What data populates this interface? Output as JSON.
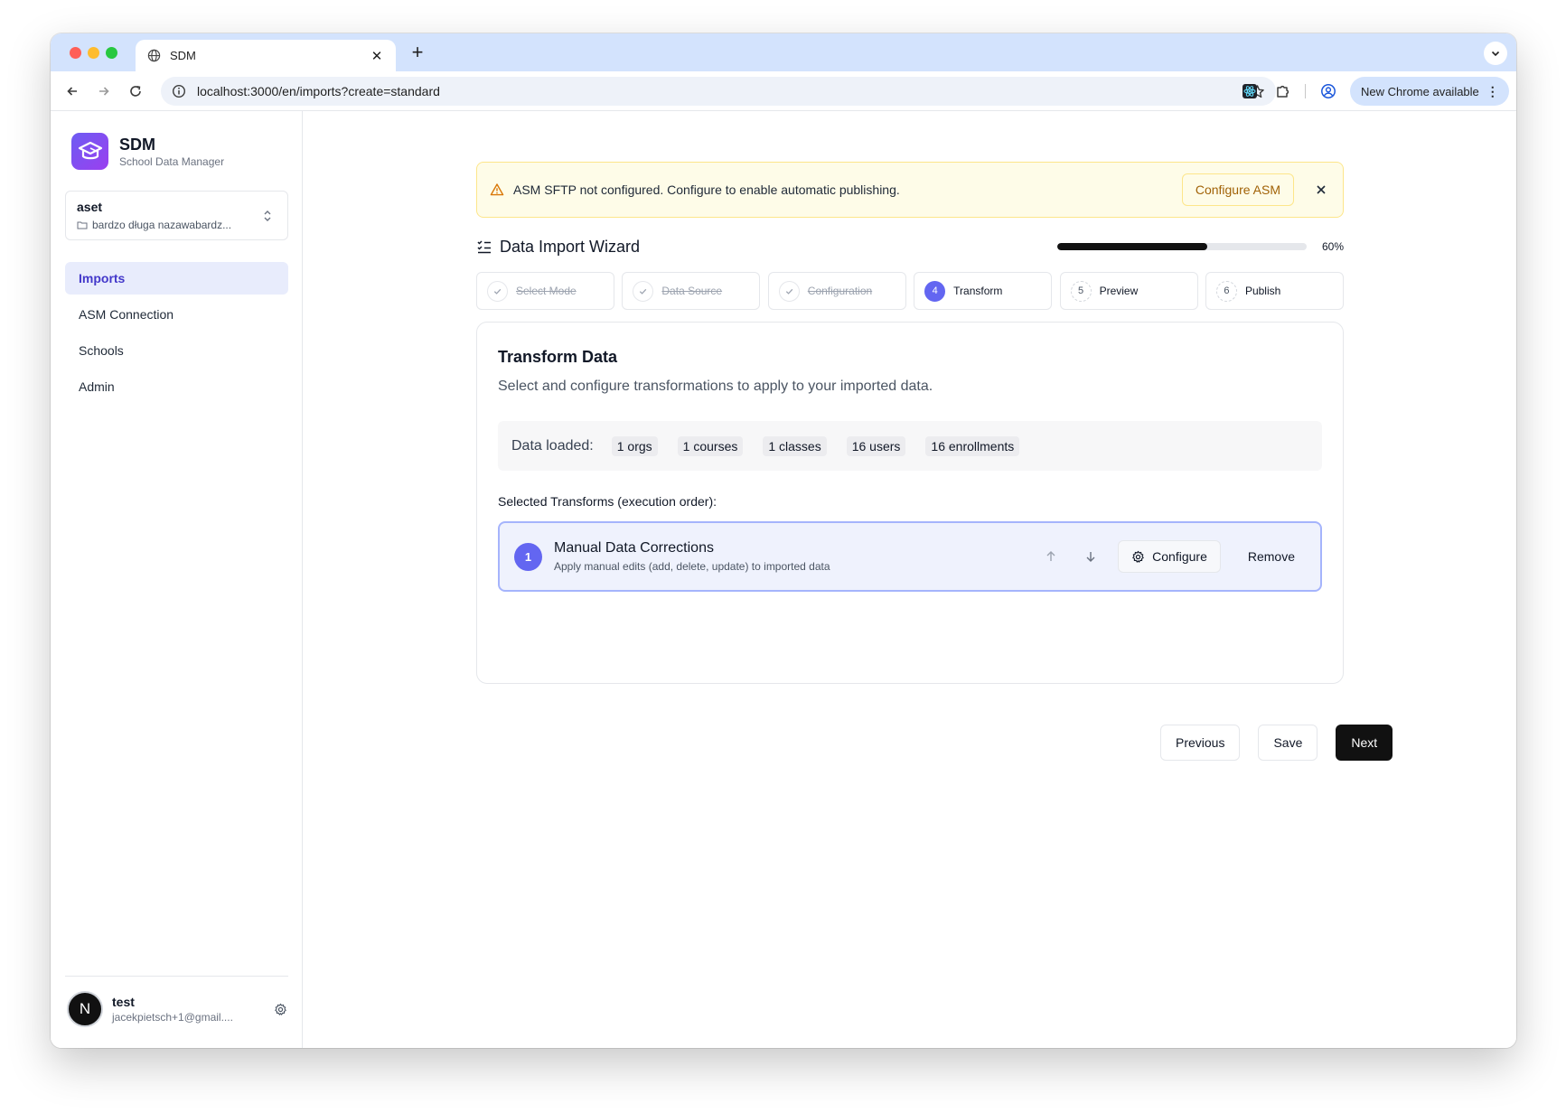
{
  "browser": {
    "tab_title": "SDM",
    "url": "localhost:3000/en/imports?create=standard",
    "update_label": "New Chrome available"
  },
  "sidebar": {
    "brand_name": "SDM",
    "brand_subtitle": "School Data Manager",
    "org": {
      "name": "aset",
      "subtitle": "bardzo długa nazawabardz..."
    },
    "items": [
      {
        "label": "Imports",
        "active": true
      },
      {
        "label": "ASM Connection"
      },
      {
        "label": "Schools"
      },
      {
        "label": "Admin"
      }
    ],
    "user": {
      "initial": "N",
      "name": "test",
      "email": "jacekpietsch+1@gmail...."
    }
  },
  "banner": {
    "text": "ASM SFTP not configured. Configure to enable automatic publishing.",
    "button": "Configure ASM"
  },
  "wizard": {
    "title": "Data Import Wizard",
    "progress": 60,
    "progress_label": "60%",
    "steps": [
      {
        "num": "1",
        "label": "Select Mode",
        "state": "done"
      },
      {
        "num": "2",
        "label": "Data Source",
        "state": "done"
      },
      {
        "num": "3",
        "label": "Configuration",
        "state": "done"
      },
      {
        "num": "4",
        "label": "Transform",
        "state": "current"
      },
      {
        "num": "5",
        "label": "Preview",
        "state": "pending"
      },
      {
        "num": "6",
        "label": "Publish",
        "state": "pending"
      }
    ]
  },
  "transform": {
    "title": "Transform Data",
    "description": "Select and configure transformations to apply to your imported data.",
    "loaded_label": "Data loaded:",
    "loaded": [
      "1 orgs",
      "1 courses",
      "1 classes",
      "16 users",
      "16 enrollments"
    ],
    "selected_label": "Selected Transforms (execution order):",
    "items": [
      {
        "num": "1",
        "name": "Manual Data Corrections",
        "description": "Apply manual edits (add, delete, update) to imported data",
        "configure_label": "Configure",
        "remove_label": "Remove"
      }
    ]
  },
  "actions": {
    "previous": "Previous",
    "save": "Save",
    "next": "Next"
  },
  "colors": {
    "accent": "#6366f1",
    "warning_bg": "#fefce8",
    "warning_text": "#a16207",
    "primary_button": "#111111"
  }
}
